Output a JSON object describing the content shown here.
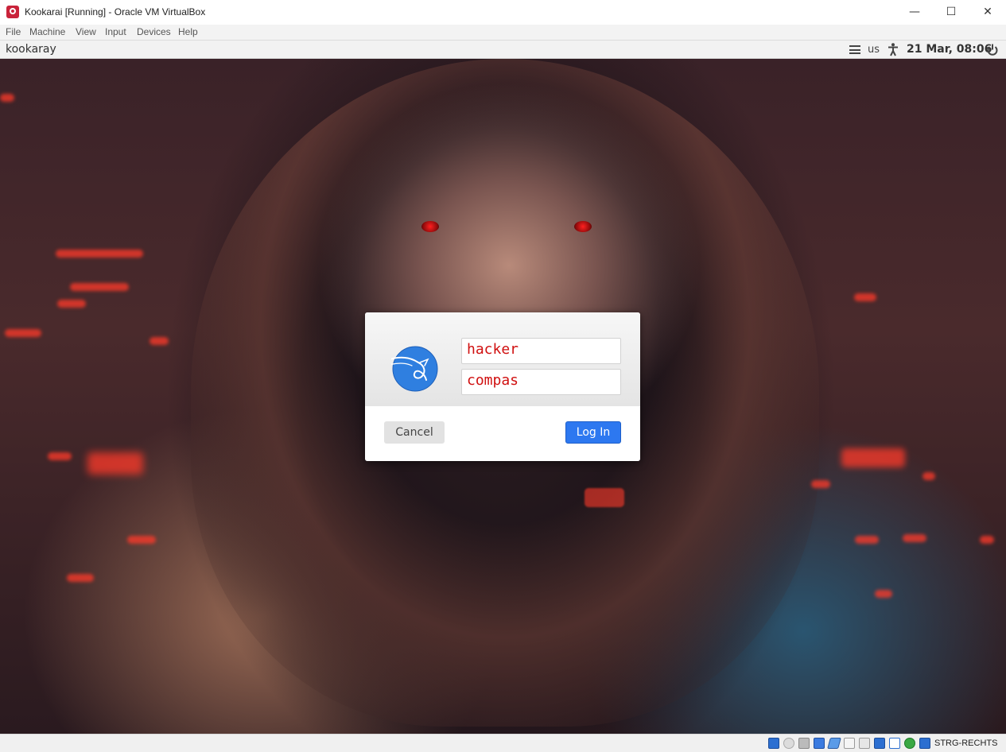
{
  "window": {
    "title": "Kookarai [Running] - Oracle VM VirtualBox",
    "controls": {
      "minimize": "—",
      "maximize": "☐",
      "close": "✕"
    }
  },
  "menu": [
    "File",
    "Machine",
    "View",
    "Input",
    "Devices",
    "Help"
  ],
  "guest_panel": {
    "hostname": "kookaray",
    "keyboard_layout": "us",
    "datetime": "21 Mar, 08:06"
  },
  "login": {
    "username": "hacker",
    "password": "compas",
    "cancel_label": "Cancel",
    "login_label": "Log In"
  },
  "statusbar": {
    "host_key": "STRG-RECHTS",
    "icons": [
      "hard-disk-icon",
      "optical-drive-icon",
      "audio-icon",
      "network-icon",
      "usb-icon",
      "shared-folders-icon",
      "display-icon",
      "video-capture-icon",
      "virtualization-icon",
      "mouse-integration-icon",
      "arrow-down-icon"
    ]
  },
  "colors": {
    "accent": "#2d78f0",
    "field_text": "#d01010",
    "kali_logo": "#2f7fe0"
  }
}
